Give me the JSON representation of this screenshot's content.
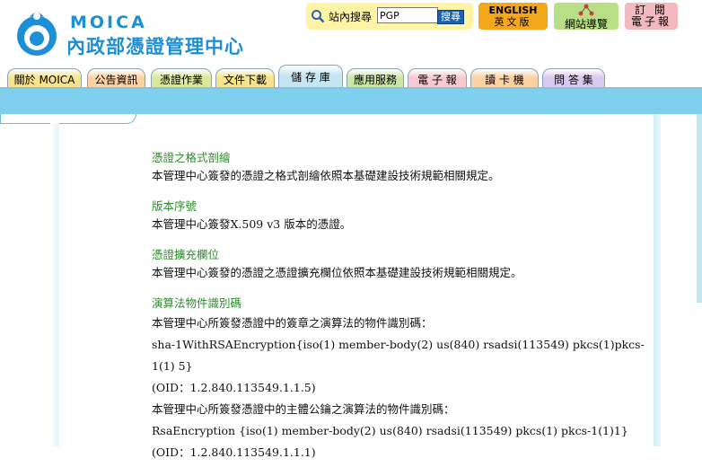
{
  "header": {
    "logo_en": "MOICA",
    "logo_zh": "內政部憑證管理中心",
    "search": {
      "label": "站內搜尋",
      "value": "PGP",
      "button_label": "搜尋"
    },
    "english_button": {
      "line1": "ENGLISH",
      "line2": "英文版"
    },
    "sitemap_button": {
      "label": "網站導覽"
    },
    "newsletter_button": {
      "line1": "訂 閱",
      "line2": "電子報"
    }
  },
  "nav": {
    "tabs": [
      {
        "label": "關於 MOICA",
        "color": "#f6e38a"
      },
      {
        "label": "公告資訊",
        "color": "#fcd2a5"
      },
      {
        "label": "憑證作業",
        "color": "#dbe79a"
      },
      {
        "label": "文件下載",
        "color": "#f6e38a"
      },
      {
        "label": "儲 存 庫",
        "color": "#c4e6f2"
      },
      {
        "label": "應用服務",
        "color": "#cde5a7"
      },
      {
        "label": "電 子 報",
        "color": "#f8c9d0"
      },
      {
        "label": "讀 卡 機",
        "color": "#fcd2a5"
      },
      {
        "label": "問 答 集",
        "color": "#d8c9ee"
      }
    ]
  },
  "sections": [
    {
      "title": "憑證之格式剖繪",
      "lines": [
        "本管理中心簽發的憑證之格式剖繪依照本基礎建設技術規範相關規定。"
      ]
    },
    {
      "title": "版本序號",
      "lines": [
        "本管理中心簽發X.509 v3 版本的憑證。"
      ]
    },
    {
      "title": "憑證擴充欄位",
      "lines": [
        "本管理中心簽發的憑證之憑證擴充欄位依照本基礎建設技術規範相關規定。"
      ]
    },
    {
      "title": "演算法物件識別碼",
      "lines": [
        "本管理中心所簽發憑證中的簽章之演算法的物件識別碼：",
        "sha-1WithRSAEncryption{iso(1) member-body(2) us(840) rsadsi(113549) pkcs(1)pkcs-1(1) 5}",
        "(OID：1.2.840.113549.1.1.5)",
        "本管理中心所簽發憑證中的主體公鑰之演算法的物件識別碼：",
        "RsaEncryption {iso(1) member-body(2) us(840) rsadsi(113549) pkcs(1) pkcs-1(1)1}",
        "(OID：1.2.840.113549.1.1.1)"
      ]
    }
  ],
  "colors": {
    "brand_blue": "#1d8fd6",
    "band": "#7fd0ee",
    "section_title": "#2e8b2e"
  }
}
